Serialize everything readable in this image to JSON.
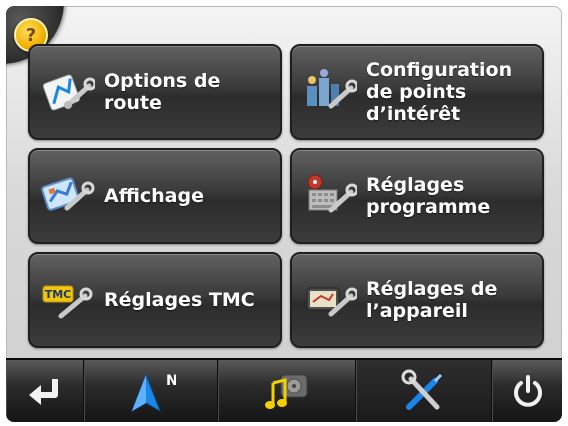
{
  "help": {
    "label": "?"
  },
  "menu": [
    {
      "id": "route-options",
      "label": "Options de\nroute",
      "icon": "route-options-icon"
    },
    {
      "id": "poi-config",
      "label": "Configuration\nde points\nd’intérêt",
      "icon": "poi-config-icon"
    },
    {
      "id": "display",
      "label": "Affichage",
      "icon": "display-icon"
    },
    {
      "id": "program-settings",
      "label": "Réglages\nprogramme",
      "icon": "program-settings-icon"
    },
    {
      "id": "tmc-settings",
      "label": "Réglages TMC",
      "icon": "tmc-icon",
      "badge": "TMC"
    },
    {
      "id": "device-settings",
      "label": "Réglages de\nl’appareil",
      "icon": "device-settings-icon"
    }
  ],
  "bottombar": {
    "north_label": "N",
    "buttons": [
      "back-icon",
      "navigation-arrow-icon",
      "music-icon",
      "settings-tools-icon",
      "power-icon"
    ],
    "active": "settings-tools-icon"
  },
  "colors": {
    "tile": "#3a3a3a",
    "accent_blue": "#1c86e6",
    "help_yellow": "#f2b100"
  }
}
